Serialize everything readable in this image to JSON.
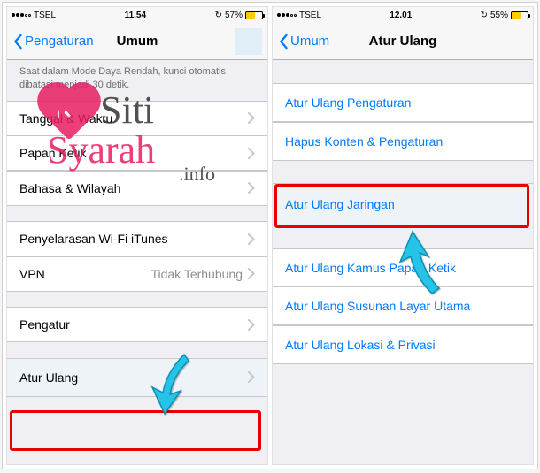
{
  "left": {
    "status": {
      "carrier": "TSEL",
      "time": "11.54",
      "battery_pct": "57%",
      "battery_fill": 57
    },
    "nav": {
      "back": "Pengaturan",
      "title": "Umum"
    },
    "note": "Saat dalam Mode Daya Rendah, kunci otomatis dibatasi menjadi 30 detik.",
    "rows": {
      "date": "Tanggal & Waktu",
      "keyboard": "Papan Ketik",
      "language": "Bahasa & Wilayah",
      "itunes": "Penyelarasan Wi-Fi iTunes",
      "vpn": "VPN",
      "vpn_value": "Tidak Terhubung",
      "regulator": "Pengatur",
      "reset": "Atur Ulang"
    }
  },
  "right": {
    "status": {
      "carrier": "TSEL",
      "time": "12.01",
      "battery_pct": "55%",
      "battery_fill": 55
    },
    "nav": {
      "back": "Umum",
      "title": "Atur Ulang"
    },
    "rows": {
      "reset_settings": "Atur Ulang Pengaturan",
      "erase": "Hapus Konten & Pengaturan",
      "network": "Atur Ulang Jaringan",
      "dict": "Atur Ulang Kamus Papan Ketik",
      "home": "Atur Ulang Susunan Layar Utama",
      "location": "Atur Ulang Lokasi & Privasi"
    }
  },
  "watermark": {
    "line1": "Siti",
    "line2": "Syarah",
    "line3": ".info",
    "heart": "I ❤"
  },
  "icons": {
    "sync": "↻"
  }
}
